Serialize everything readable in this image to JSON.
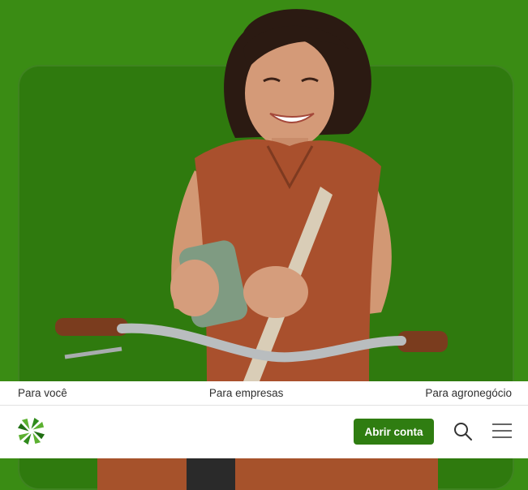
{
  "segments": {
    "personal": "Para você",
    "business": "Para empresas",
    "agro": "Para agronegócio"
  },
  "nav": {
    "cta_label": "Abrir conta",
    "search_icon": "search-icon",
    "menu_icon": "menu-icon",
    "logo_icon": "pinwheel-logo-icon"
  },
  "colors": {
    "brand_green": "#2f7d11",
    "hero_background": "#3a8c14"
  }
}
